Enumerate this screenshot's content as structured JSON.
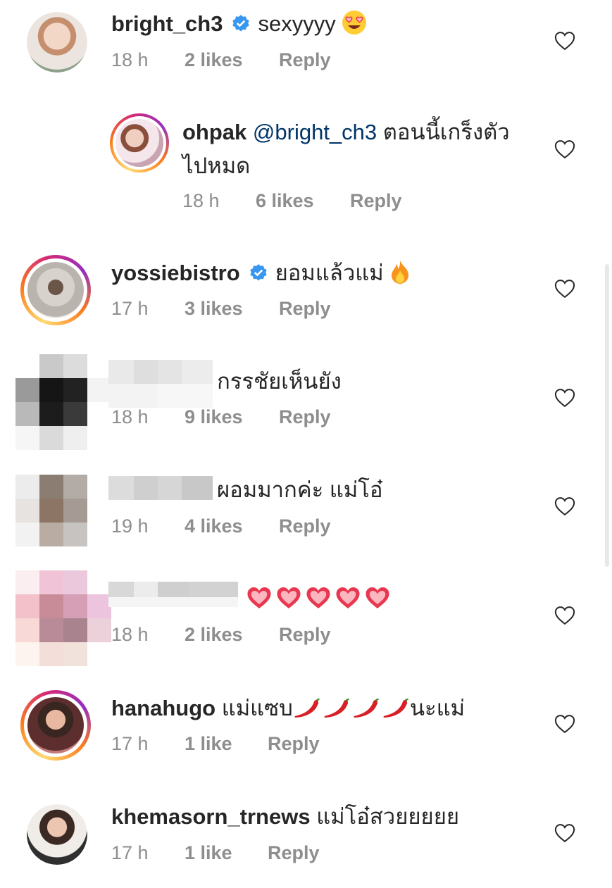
{
  "comments": [
    {
      "username": "bright_ch3",
      "verified": true,
      "text": "sexyyyy",
      "emoji": "heart-eyes",
      "time": "18 h",
      "likes": "2 likes",
      "reply": "Reply"
    },
    {
      "username": "ohpak",
      "mention": "@bright_ch3",
      "text": "ตอนนี้เกร็งตัว",
      "text2": "ไปหมด",
      "time": "18 h",
      "likes": "6 likes",
      "reply": "Reply"
    },
    {
      "username": "yossiebistro",
      "verified": true,
      "text": "ยอมแล้วแม่",
      "emoji": "fire",
      "time": "17 h",
      "likes": "3 likes",
      "reply": "Reply"
    },
    {
      "username": "",
      "text": "กรรชัยเห็นยัง",
      "time": "18 h",
      "likes": "9 likes",
      "reply": "Reply"
    },
    {
      "username": "",
      "text": "ผอมมากค่ะ แม่โอ๋",
      "time": "19 h",
      "likes": "4 likes",
      "reply": "Reply"
    },
    {
      "username": "",
      "text": "",
      "emoji": "hearts-x5",
      "time": "18 h",
      "likes": "2 likes",
      "reply": "Reply"
    },
    {
      "username": "hanahugo",
      "text": "แม่แซบ",
      "text2": "นะแม่",
      "emoji": "chili-x4",
      "time": "17 h",
      "likes": "1 like",
      "reply": "Reply"
    },
    {
      "username": "khemasorn_trnews",
      "text": "แม่โอ๋สวยยยยย",
      "time": "17 h",
      "likes": "1 like",
      "reply": "Reply"
    }
  ],
  "icons": {
    "like": "heart-outline-icon",
    "verified": "verified-badge-icon"
  },
  "colors": {
    "text": "#262626",
    "meta": "#8e8e8e",
    "mention": "#003569",
    "verified": "#3897f0"
  }
}
